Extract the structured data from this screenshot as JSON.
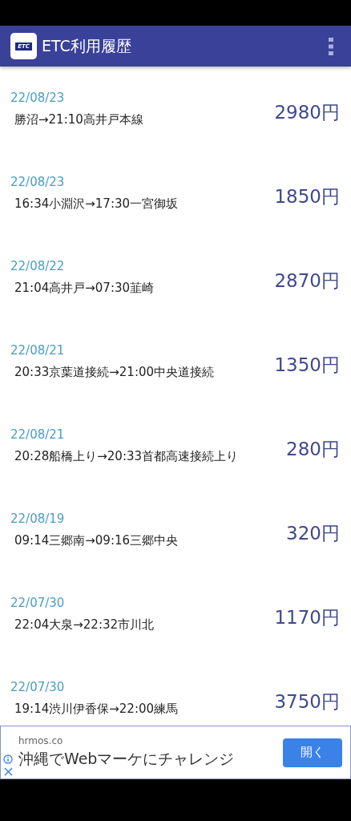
{
  "app_bar": {
    "title": "ETC利用履歴",
    "logo_text": "ETC"
  },
  "history": [
    {
      "date": "22/08/23",
      "route": "勝沼→21:10高井戸本線",
      "price": "2980円"
    },
    {
      "date": "22/08/23",
      "route": "16:34小淵沢→17:30一宮御坂",
      "price": "1850円"
    },
    {
      "date": "22/08/22",
      "route": "21:04高井戸→07:30韮崎",
      "price": "2870円"
    },
    {
      "date": "22/08/21",
      "route": "20:33京葉道接続→21:00中央道接続",
      "price": "1350円"
    },
    {
      "date": "22/08/21",
      "route": "20:28船橋上り→20:33首都高速接続上り",
      "price": "280円"
    },
    {
      "date": "22/08/19",
      "route": "09:14三郷南→09:16三郷中央",
      "price": "320円"
    },
    {
      "date": "22/07/30",
      "route": "22:04大泉→22:32市川北",
      "price": "1170円"
    },
    {
      "date": "22/07/30",
      "route": "19:14渋川伊香保→22:00練馬",
      "price": "3750円"
    }
  ],
  "ad": {
    "domain": "hrmos.co",
    "headline": "沖縄でWebマーケにチャレンジ",
    "button": "開く"
  }
}
